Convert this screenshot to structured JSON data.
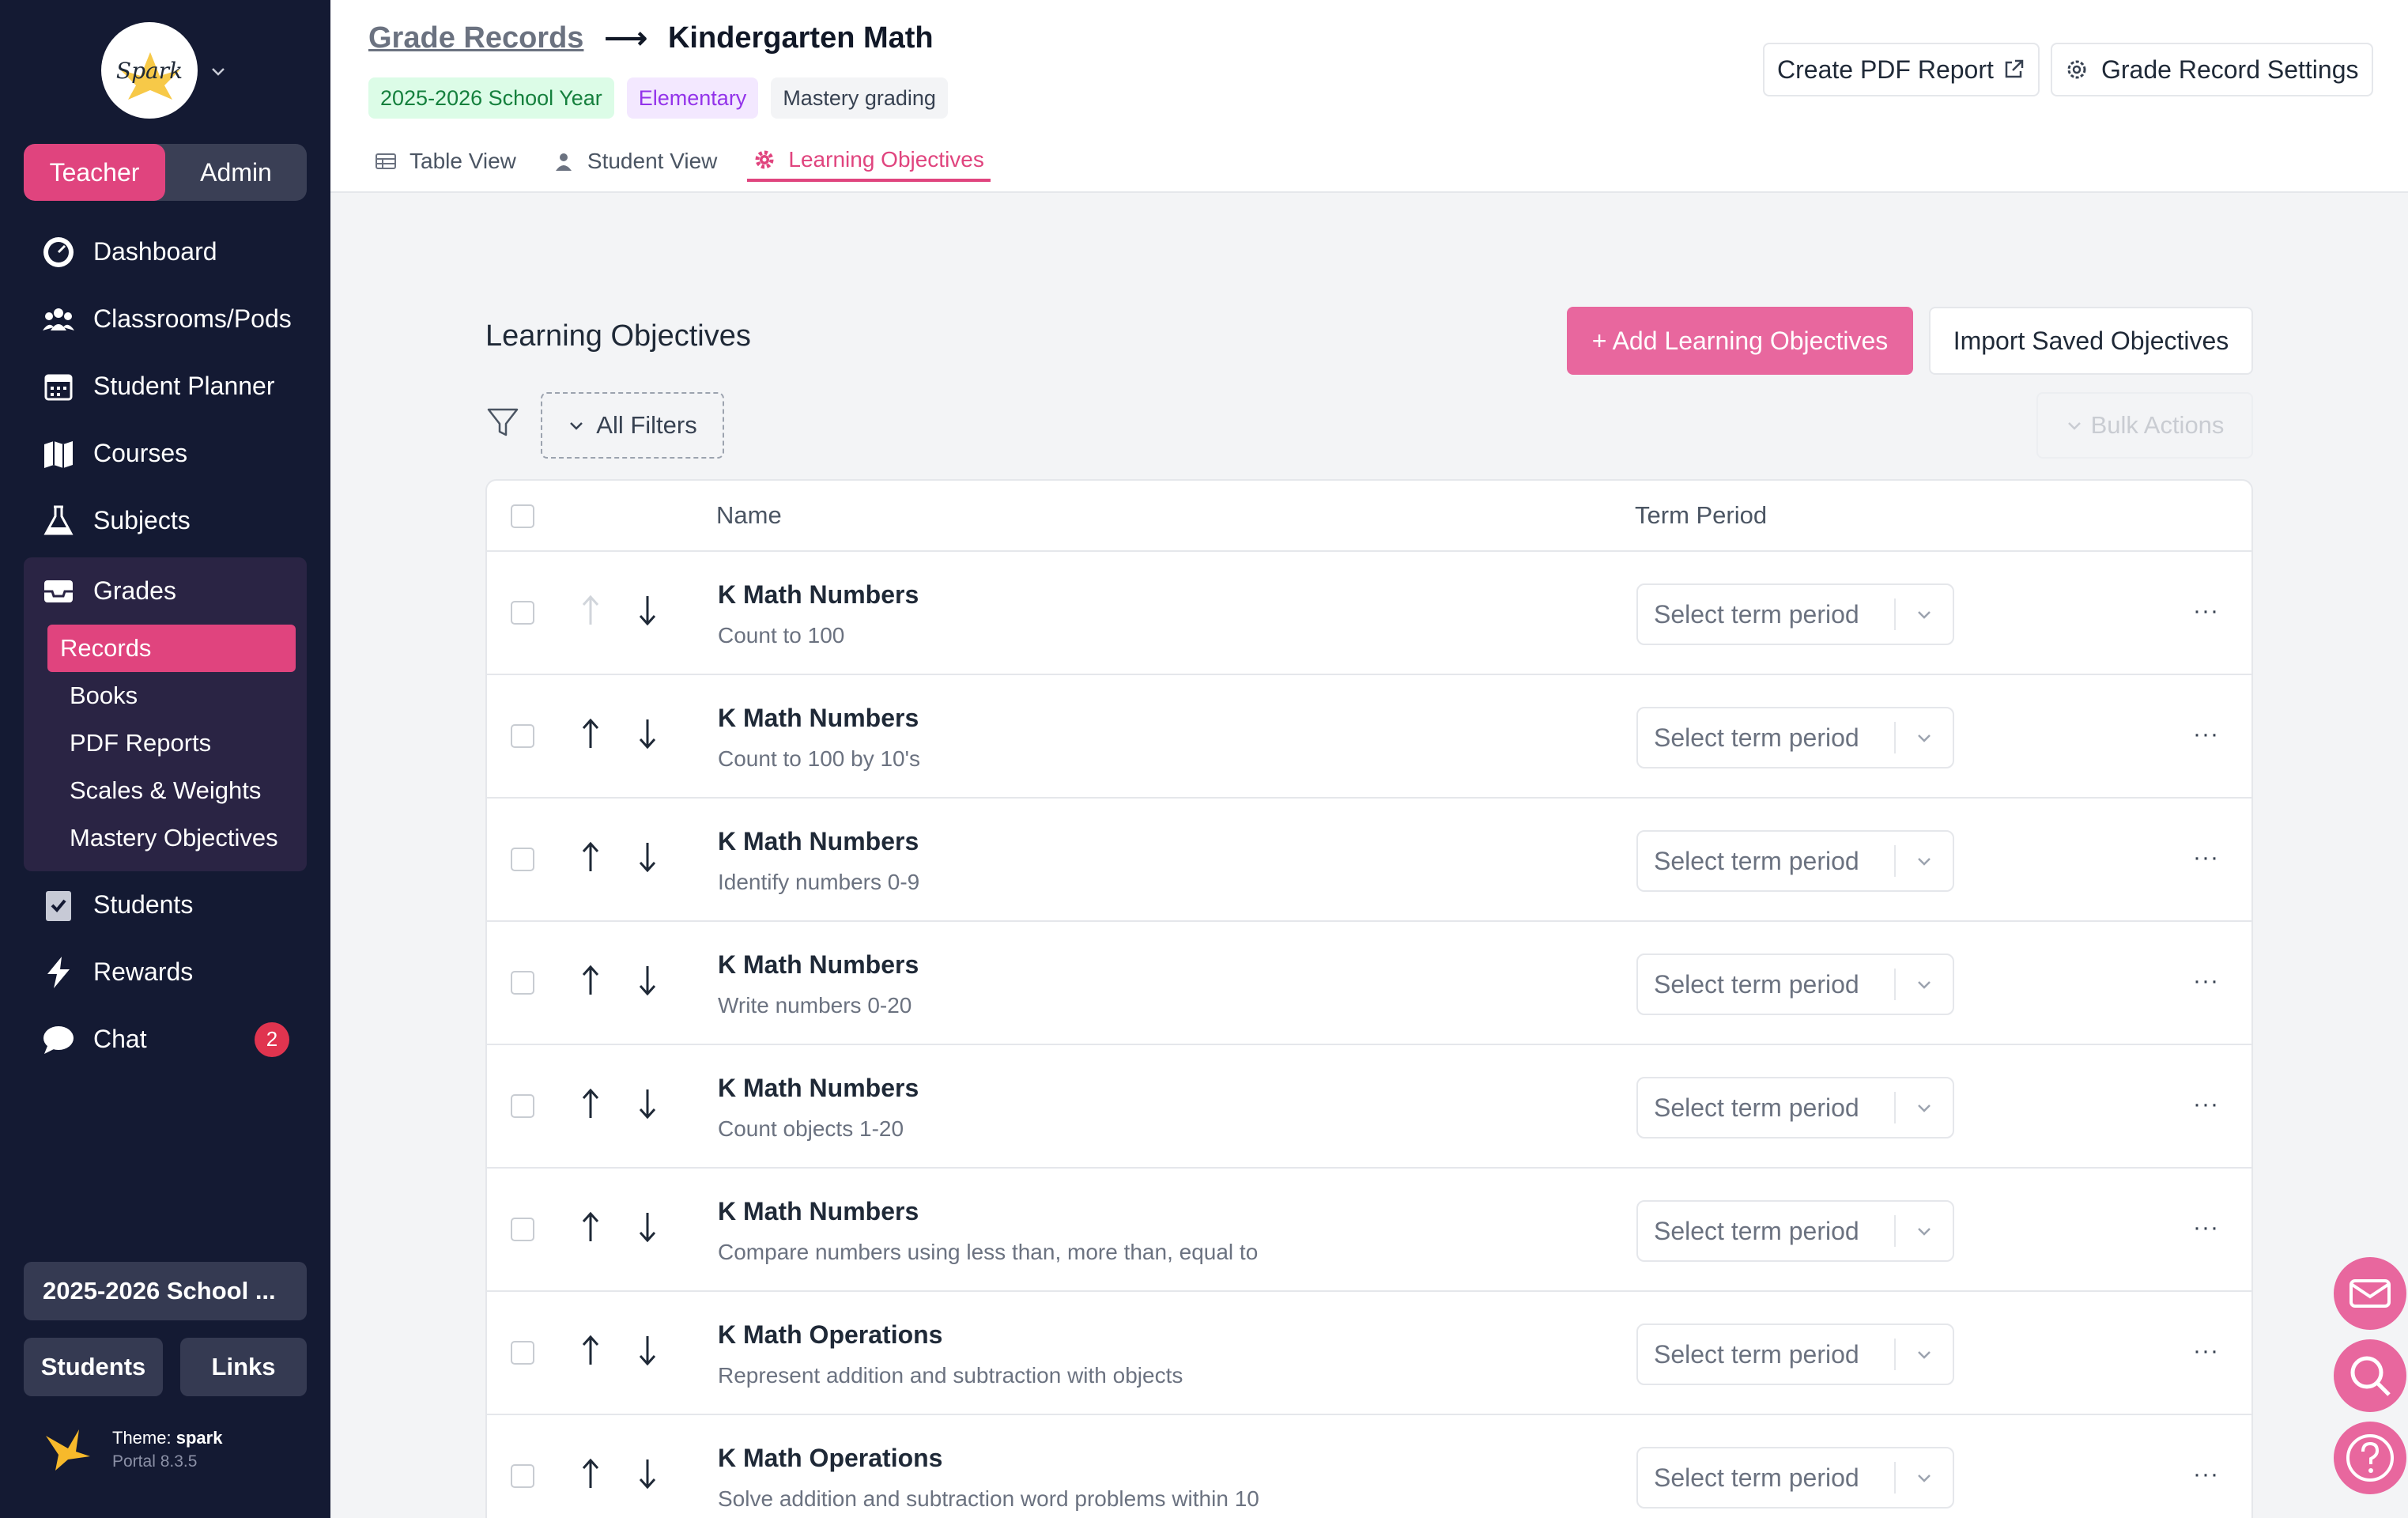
{
  "sidebar": {
    "logo_text": "Spark",
    "roles": {
      "teacher": "Teacher",
      "admin": "Admin"
    },
    "nav": {
      "dashboard": "Dashboard",
      "classrooms": "Classrooms/Pods",
      "planner": "Student Planner",
      "courses": "Courses",
      "subjects": "Subjects",
      "grades": "Grades",
      "students": "Students",
      "rewards": "Rewards",
      "chat": "Chat",
      "chat_badge": "2"
    },
    "grades_sub": [
      "Records",
      "Books",
      "PDF Reports",
      "Scales & Weights",
      "Mastery Objectives"
    ],
    "year_select": "2025-2026 School ...",
    "students_btn": "Students",
    "links_btn": "Links",
    "theme_label": "Theme:",
    "theme_name": "spark",
    "version": "Portal 8.3.5"
  },
  "header": {
    "crumb_link": "Grade Records",
    "crumb_arrow": "⟶",
    "title": "Kindergarten Math",
    "chips": [
      "2025-2026 School Year",
      "Elementary",
      "Mastery grading"
    ],
    "tabs": [
      "Table View",
      "Student View",
      "Learning Objectives"
    ],
    "pdf_btn": "Create PDF Report",
    "settings_btn": "Grade Record Settings"
  },
  "main": {
    "title": "Learning Objectives",
    "add_btn": "+ Add Learning Objectives",
    "import_btn": "Import Saved Objectives",
    "filters_btn": "All Filters",
    "bulk_btn": "Bulk Actions",
    "col_name": "Name",
    "col_term": "Term Period",
    "term_placeholder": "Select term period",
    "more_label": "···",
    "rows": [
      {
        "name": "K Math Numbers",
        "desc": "Count to 100"
      },
      {
        "name": "K Math Numbers",
        "desc": "Count to 100 by 10's"
      },
      {
        "name": "K Math Numbers",
        "desc": "Identify numbers 0-9"
      },
      {
        "name": "K Math Numbers",
        "desc": "Write numbers 0-20"
      },
      {
        "name": "K Math Numbers",
        "desc": "Count objects 1-20"
      },
      {
        "name": "K Math Numbers",
        "desc": "Compare numbers using less than, more than, equal to"
      },
      {
        "name": "K Math Operations",
        "desc": "Represent addition and subtraction with objects"
      },
      {
        "name": "K Math Operations",
        "desc": "Solve addition and subtraction word problems within 10"
      }
    ]
  },
  "colors": {
    "accent": "#e0447e",
    "sidebar_bg": "#141a33",
    "chip_green": "#dcfce7",
    "chip_purple": "#f3e8ff"
  }
}
